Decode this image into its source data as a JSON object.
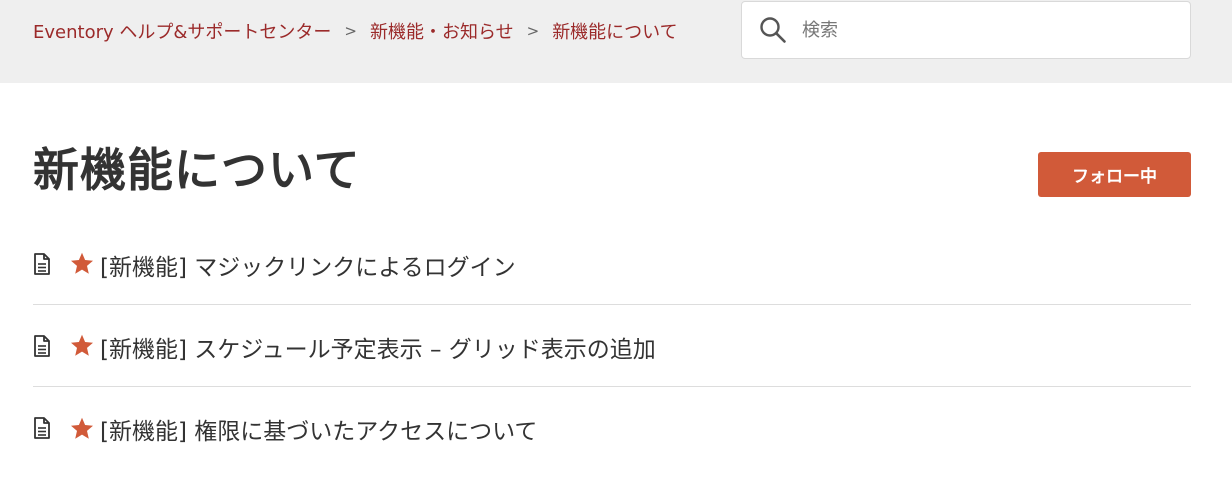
{
  "breadcrumb": {
    "items": [
      {
        "label": "Eventory ヘルプ&サポートセンター"
      },
      {
        "label": "新機能・お知らせ"
      },
      {
        "label": "新機能について"
      }
    ],
    "separator": ">"
  },
  "search": {
    "placeholder": "検索",
    "icon": "search-icon"
  },
  "page": {
    "title": "新機能について"
  },
  "follow_button": {
    "label": "フォロー中",
    "color": "#d15a39"
  },
  "articles": [
    {
      "title": "[新機能] マジックリンクによるログイン",
      "promoted": true
    },
    {
      "title": "[新機能] スケジュール予定表示 – グリッド表示の追加",
      "promoted": true
    },
    {
      "title": "[新機能] 権限に基づいたアクセスについて",
      "promoted": true
    }
  ],
  "colors": {
    "accent": "#d15a39",
    "breadcrumb_link": "#9b2a2a",
    "topbar_bg": "#efefef"
  }
}
